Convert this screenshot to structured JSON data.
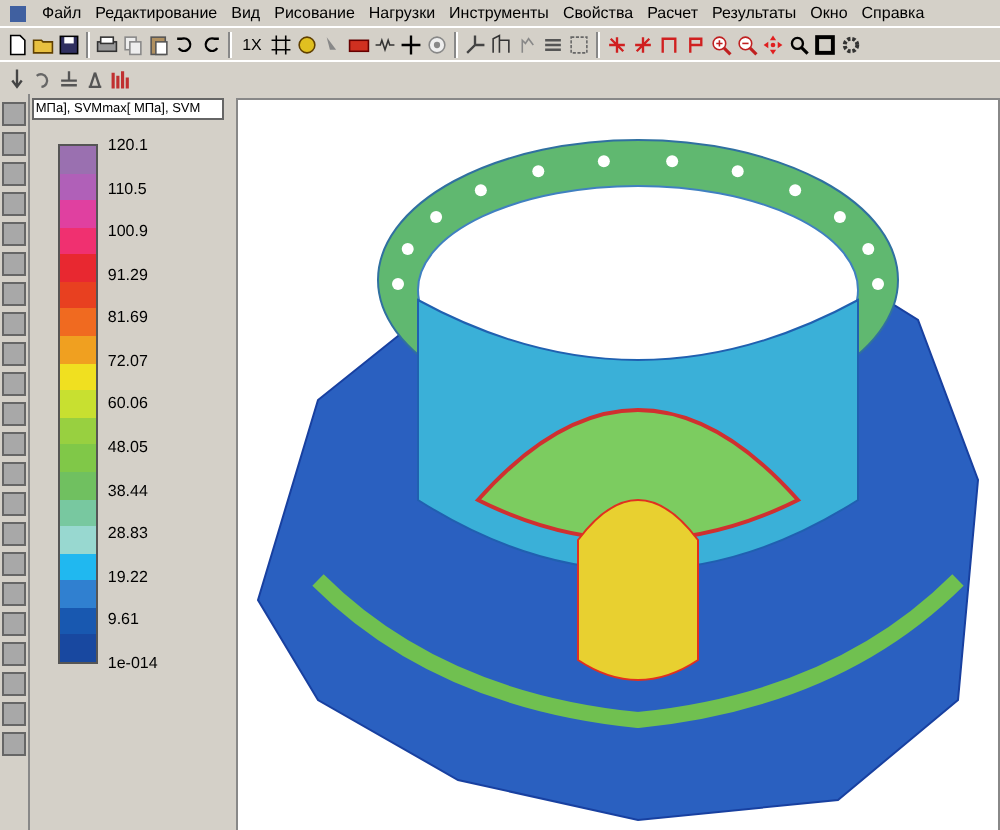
{
  "menu": [
    "Файл",
    "Редактирование",
    "Вид",
    "Рисование",
    "Нагрузки",
    "Инструменты",
    "Свойства",
    "Расчет",
    "Результаты",
    "Окно",
    "Справка"
  ],
  "toolbar": {
    "zoom_label": "1X"
  },
  "legend": {
    "header": "МПа], SVMmax[ МПа], SVM",
    "labels": [
      "120.1",
      "110.5",
      "100.9",
      "91.29",
      "81.69",
      "72.07",
      "60.06",
      "48.05",
      "38.44",
      "28.83",
      "19.22",
      "9.61",
      "1e-014"
    ],
    "bands": [
      {
        "color": "#9a70b0"
      },
      {
        "color": "#b060b8"
      },
      {
        "color": "#e040a0"
      },
      {
        "color": "#f03070"
      },
      {
        "color": "#e82830"
      },
      {
        "color": "#e84020"
      },
      {
        "color": "#f06a20"
      },
      {
        "color": "#f0a020"
      },
      {
        "color": "#f0e020"
      },
      {
        "color": "#c8e030"
      },
      {
        "color": "#98d040"
      },
      {
        "color": "#80c848"
      },
      {
        "color": "#70c060"
      },
      {
        "color": "#78c8a0"
      },
      {
        "color": "#98d8d0"
      },
      {
        "color": "#20b8f0"
      },
      {
        "color": "#3080d0"
      },
      {
        "color": "#1858b0"
      },
      {
        "color": "#1848a0"
      }
    ]
  }
}
